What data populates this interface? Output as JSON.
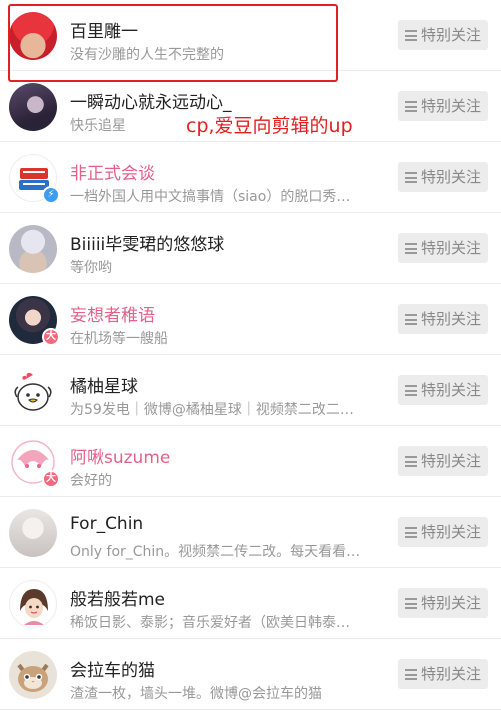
{
  "follow_label": "特别关注",
  "accounts": [
    {
      "name": "百里雕一",
      "desc": "没有沙雕的人生不完整的",
      "name_color": "default",
      "badge": null
    },
    {
      "name": "一瞬动心就永远动心_",
      "desc": "快乐追星",
      "name_color": "default",
      "badge": null
    },
    {
      "name": "非正式会谈",
      "desc": "一档外国人用中文搞事情（siao）的脱口秀…",
      "name_color": "pink",
      "badge": "verified-lightning"
    },
    {
      "name": "Biiiii毕雯珺的悠悠球",
      "desc": "等你哟",
      "name_color": "default",
      "badge": null
    },
    {
      "name": "妄想者稚语",
      "desc": "在机场等一艘船",
      "name_color": "pink",
      "badge": "大"
    },
    {
      "name": "橘柚星球",
      "desc": "为59发电｜微博@橘柚星球｜视频禁二改二…",
      "name_color": "default",
      "badge": null
    },
    {
      "name": "阿啾suzume",
      "desc": "会好的",
      "name_color": "pink",
      "badge": "大"
    },
    {
      "name": "For_Chin",
      "desc": "Only for_Chin。视频禁二传二改。每天看看…",
      "name_color": "default",
      "badge": null
    },
    {
      "name": "般若般若me",
      "desc": "稀饭日影、泰影；音乐爱好者（欧美日韩泰…",
      "name_color": "default",
      "badge": null
    },
    {
      "name": "会拉车的猫",
      "desc": "渣渣一枚，墙头一堆。微博@会拉车的猫",
      "name_color": "default",
      "badge": null
    }
  ],
  "annotation": "cp,爱豆向剪辑的up",
  "colors": {
    "pink": "#e5608a",
    "annotation_red": "#e32020",
    "button_bg": "#ececec"
  }
}
